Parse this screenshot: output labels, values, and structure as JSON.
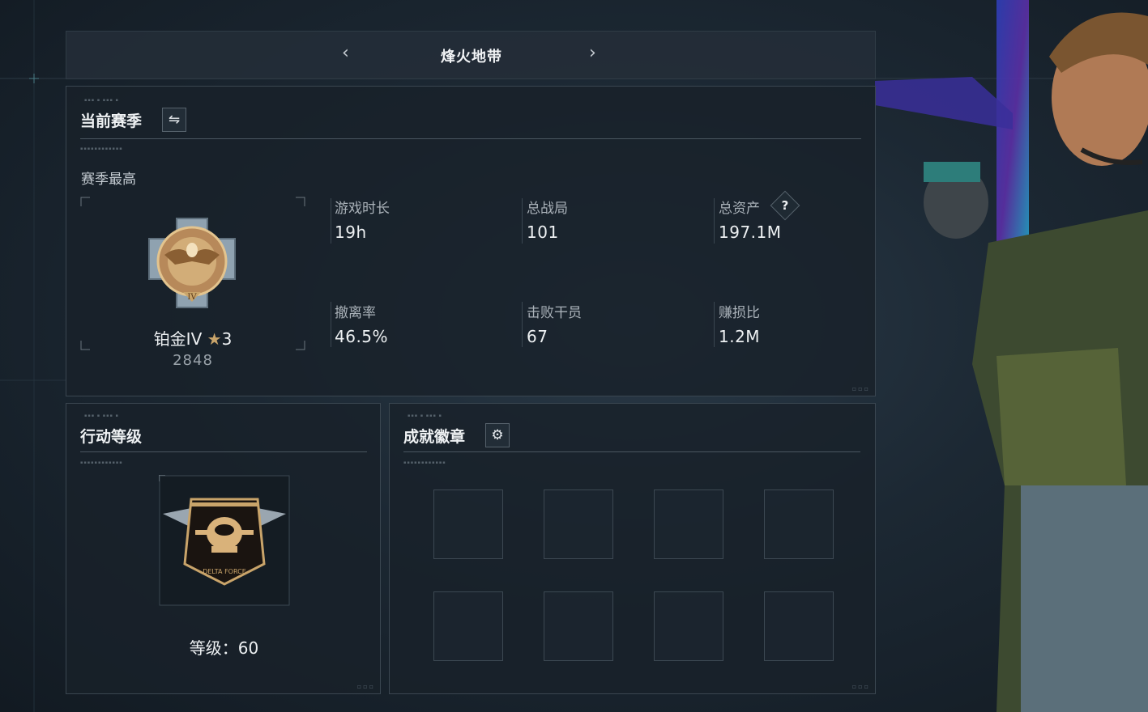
{
  "nav": {
    "title": "烽火地带",
    "prev_icon": "chevron-left-icon",
    "next_icon": "chevron-right-icon"
  },
  "season": {
    "title": "当前赛季",
    "switch_icon": "swap-arrows-icon",
    "subtitle": "赛季最高",
    "rank_name": "铂金IV",
    "rank_stars": "3",
    "rank_score": "2848",
    "stats": [
      {
        "label": "游戏时长",
        "value": "19h"
      },
      {
        "label": "总战局",
        "value": "101"
      },
      {
        "label": "总资产",
        "value": "197.1M",
        "help": "?"
      },
      {
        "label": "撤离率",
        "value": "46.5%"
      },
      {
        "label": "击败干员",
        "value": "67"
      },
      {
        "label": "赚损比",
        "value": "1.2M"
      }
    ]
  },
  "level": {
    "title": "行动等级",
    "label": "等级：60"
  },
  "achievements": {
    "title": "成就徽章",
    "settings_icon": "gear-icon",
    "slots": 8
  },
  "colors": {
    "accent_gold": "#c9a46a",
    "panel_bg": "#18212a",
    "border": "#3a4650"
  }
}
